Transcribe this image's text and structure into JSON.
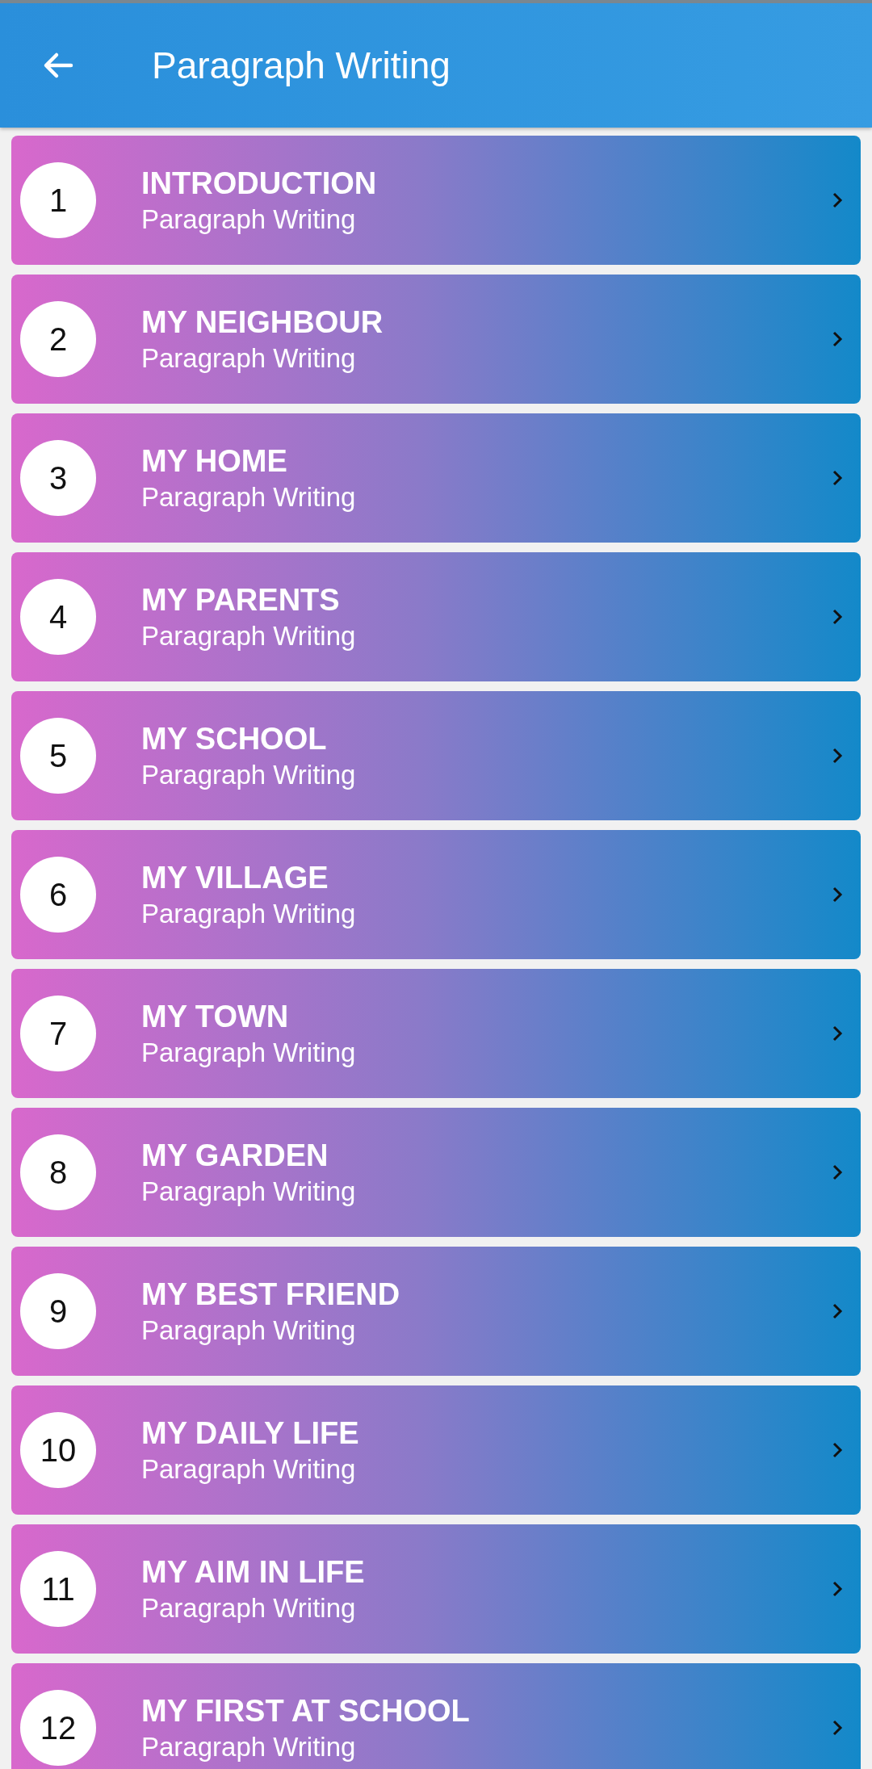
{
  "app_bar": {
    "title": "Paragraph Writing"
  },
  "items": [
    {
      "number": "1",
      "title": "INTRODUCTION",
      "subtitle": "Paragraph Writing"
    },
    {
      "number": "2",
      "title": "MY NEIGHBOUR",
      "subtitle": "Paragraph Writing"
    },
    {
      "number": "3",
      "title": "MY HOME",
      "subtitle": "Paragraph Writing"
    },
    {
      "number": "4",
      "title": "MY PARENTS",
      "subtitle": "Paragraph Writing"
    },
    {
      "number": "5",
      "title": "MY SCHOOL",
      "subtitle": "Paragraph Writing"
    },
    {
      "number": "6",
      "title": "MY VILLAGE",
      "subtitle": "Paragraph Writing"
    },
    {
      "number": "7",
      "title": "MY TOWN",
      "subtitle": "Paragraph Writing"
    },
    {
      "number": "8",
      "title": "MY GARDEN",
      "subtitle": "Paragraph Writing"
    },
    {
      "number": "9",
      "title": "MY BEST FRIEND",
      "subtitle": "Paragraph Writing"
    },
    {
      "number": "10",
      "title": "MY DAILY LIFE",
      "subtitle": "Paragraph Writing"
    },
    {
      "number": "11",
      "title": "MY AIM IN LIFE",
      "subtitle": "Paragraph Writing"
    },
    {
      "number": "12",
      "title": "MY FIRST AT SCHOOL",
      "subtitle": "Paragraph Writing"
    }
  ]
}
